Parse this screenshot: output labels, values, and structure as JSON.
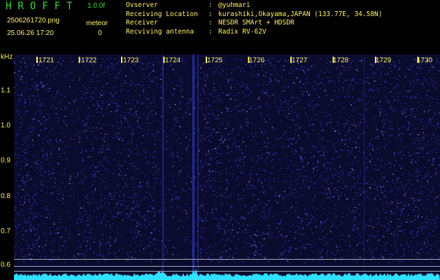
{
  "header": {
    "brand": "HROFFT",
    "version": "1.0.0f",
    "file_name": "2506261720.png",
    "timestamp": "25.06.26 17:20",
    "meteor_label": "meteor",
    "meteor_count": "0"
  },
  "info": [
    {
      "key": "Ovserver",
      "sep": ":",
      "value": "@yuhmari"
    },
    {
      "key": "Receiving Location",
      "sep": ":",
      "value": "kurashiki,Okayama,JAPAN (133.77E, 34.58N)"
    },
    {
      "key": "Receiver",
      "sep": ":",
      "value": "NESDR SMArt + HDSDR"
    },
    {
      "key": "Recviving antenna",
      "sep": ":",
      "value": "Radix RV-62V"
    }
  ],
  "spectrogram": {
    "unit": "kHz",
    "minute_labels": [
      "1721",
      "1722",
      "1723",
      "1724",
      "1725",
      "1726",
      "1727",
      "1728",
      "1729",
      "1730"
    ],
    "freq_labels": [
      "1.1",
      "1.0",
      "0.9",
      "0.8",
      "0.7",
      "0.6"
    ],
    "freq_values": [
      1.1,
      1.0,
      0.9,
      0.8,
      0.7,
      0.6
    ],
    "colors": {
      "background": "#0b0b2e",
      "noise": "#3b46d8",
      "noise_bright": "#9ea6ff",
      "spectrum": "#2fe0ff",
      "label": "#fff36a",
      "marker_line": "#cfcfcf"
    }
  }
}
